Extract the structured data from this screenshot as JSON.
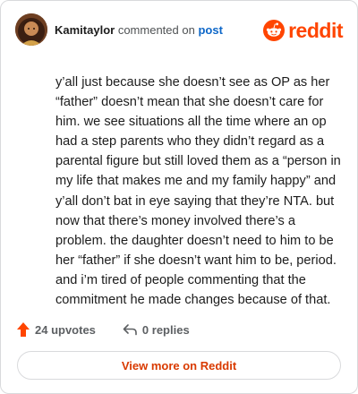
{
  "header": {
    "username": "Kamitaylor",
    "action_text": "commented on",
    "post_link": "post",
    "brand": "reddit"
  },
  "comment": {
    "text": "y’all just because she doesn’t see as OP as her “father” doesn’t mean that she doesn’t care for him. we see situations all the time where an op had a step parents who they didn’t regard as a parental figure but still loved them as a “person in my life that makes me and my family happy” and y’all don’t bat in eye saying that they’re NTA. but now that there’s money involved there’s a problem. the daughter doesn’t need to him to be her “father” if she doesn’t want him to be, period. and i’m tired of people commenting that the commitment he made changes because of that."
  },
  "footer": {
    "upvotes_label": "24 upvotes",
    "replies_label": "0 replies"
  },
  "actions": {
    "view_more_label": "View more on Reddit"
  },
  "colors": {
    "brand_orange": "#ff4500",
    "link_blue": "#0e67c8",
    "view_more_text": "#d93a00",
    "upvote_arrow": "#ff4500"
  },
  "icons": {
    "avatar": "user-avatar",
    "brand_logo": "reddit-snoo-icon",
    "upvote": "upvote-arrow-icon",
    "reply": "reply-arrow-icon"
  }
}
